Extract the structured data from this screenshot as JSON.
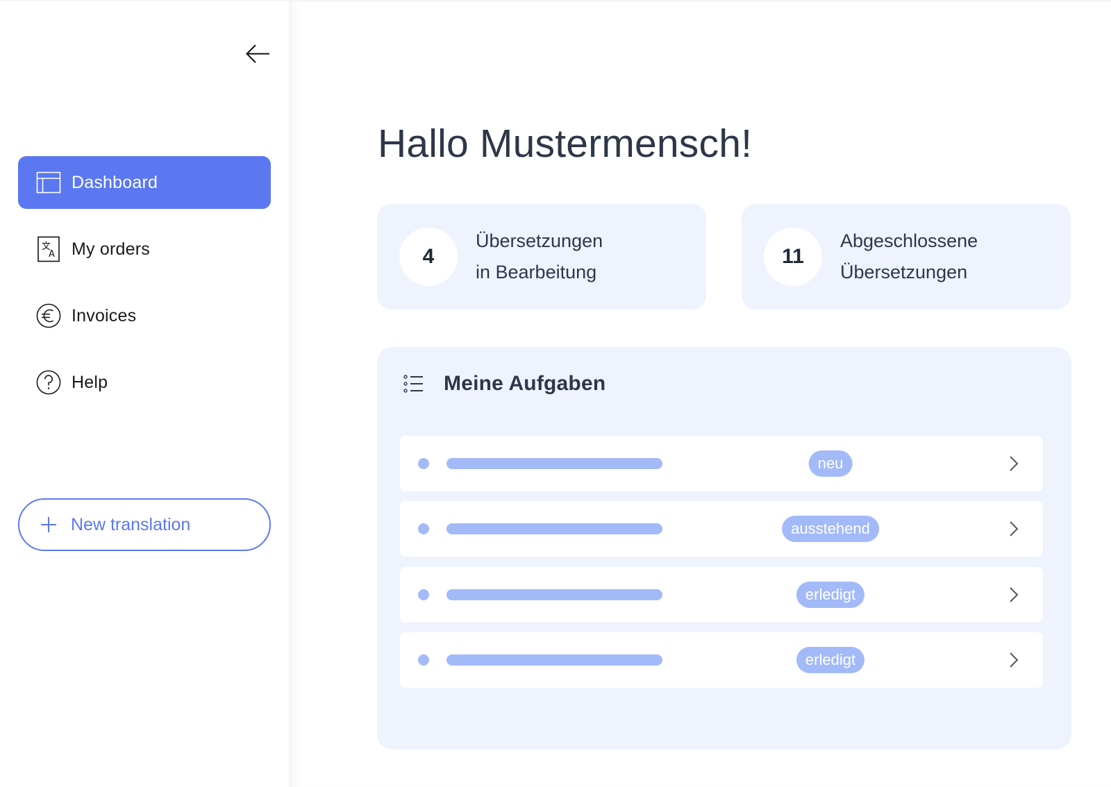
{
  "sidebar": {
    "back_icon": "arrow-left-icon",
    "items": [
      {
        "label": "Dashboard",
        "icon": "layout-icon",
        "active": true
      },
      {
        "label": "My orders",
        "icon": "translate-icon",
        "active": false
      },
      {
        "label": "Invoices",
        "icon": "euro-icon",
        "active": false
      },
      {
        "label": "Help",
        "icon": "help-icon",
        "active": false
      }
    ],
    "new_button": {
      "label": "New translation",
      "icon": "plus-icon"
    }
  },
  "main": {
    "greeting": "Hallo Mustermensch!",
    "stats": [
      {
        "value": "4",
        "line1": "Übersetzungen",
        "line2": "in Bearbeitung"
      },
      {
        "value": "11",
        "line1": "Abgeschlossene",
        "line2": "Übersetzungen"
      }
    ],
    "tasks": {
      "title": "Meine Aufgaben",
      "icon": "list-icon",
      "rows": [
        {
          "status": "neu"
        },
        {
          "status": "ausstehend"
        },
        {
          "status": "erledigt"
        },
        {
          "status": "erledigt"
        }
      ]
    }
  },
  "colors": {
    "accent": "#5b78f1",
    "badge": "#a3baf9",
    "card_bg": "#eef3fe",
    "text": "#2d3748"
  }
}
